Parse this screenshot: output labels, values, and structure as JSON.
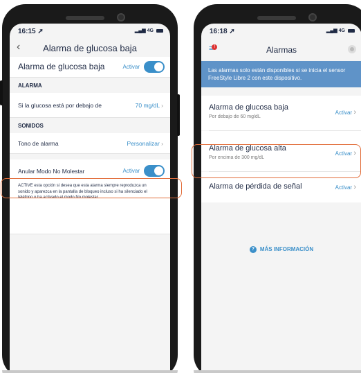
{
  "left": {
    "status_time": "16:15",
    "status_network": "4G",
    "nav_title": "Alarma de glucosa baja",
    "main_row": {
      "label": "Alarma de glucosa baja",
      "value": "Activar",
      "toggle_on": true
    },
    "section_alarm": "ALARMA",
    "threshold_row": {
      "label": "Si la glucosa está por debajo de",
      "value": "70 mg/dL"
    },
    "section_sounds": "SONIDOS",
    "tone_row": {
      "label": "Tono de alarma",
      "value": "Personalizar"
    },
    "dnd_row": {
      "label": "Anular Modo No Molestar",
      "value": "Activar",
      "toggle_on": true
    },
    "dnd_description": "ACTIVE esta opción si desea que esta alarma siempre reproduzca un sonido y aparezca en la pantalla de bloqueo incluso si ha silenciado el teléfono o ha activado el modo No molestar."
  },
  "right": {
    "status_time": "16:18",
    "status_network": "4G",
    "nav_title": "Alarmas",
    "banner": "Las alarmas solo están disponibles si se inicia el sensor FreeStyle Libre 2 con este dispositivo.",
    "alarms": [
      {
        "title": "Alarma de glucosa baja",
        "subtitle": "Por debajo de 60 mg/dL",
        "value": "Activar"
      },
      {
        "title": "Alarma de glucosa alta",
        "subtitle": "Por encima de 300 mg/dL",
        "value": "Activar"
      },
      {
        "title": "Alarma de pérdida de señal",
        "subtitle": "",
        "value": "Activar"
      }
    ],
    "more_info": "MÁS INFORMACIÓN"
  },
  "colors": {
    "accent": "#3a8fc9",
    "highlight": "#e26d3a",
    "banner": "#5f93c8",
    "text": "#1f2a44"
  },
  "icons": [
    "location-arrow-icon",
    "signal-icon",
    "battery-icon",
    "back-chevron-icon",
    "chevron-right-icon",
    "menu-alert-icon",
    "sensor-icon",
    "info-icon"
  ]
}
